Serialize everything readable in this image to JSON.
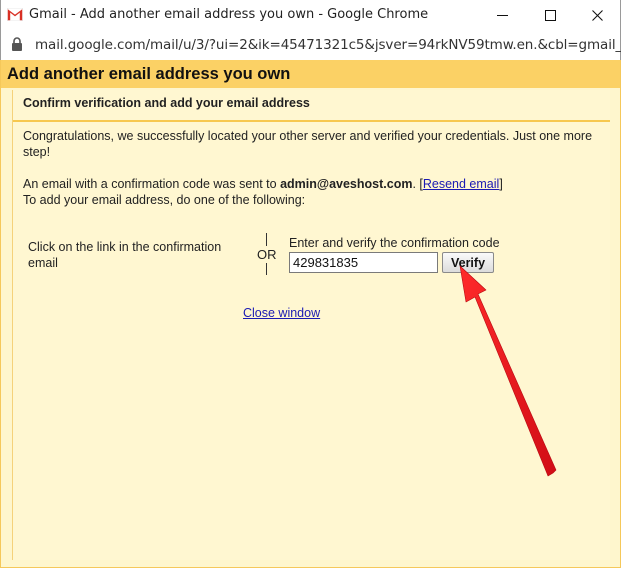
{
  "window": {
    "title": "Gmail - Add another email address you own - Google Chrome",
    "url": "mail.google.com/mail/u/3/?ui=2&ik=45471321c5&jsver=94rkNV59tmw.en.&cbl=gmail_fe...",
    "minimize_glyph": "—",
    "maximize_glyph": "☐",
    "close_glyph": "✕"
  },
  "page": {
    "title": "Add another email address you own",
    "section_title": "Confirm verification and add your email address",
    "congrats_text": "Congratulations, we successfully located your other server and verified your credentials. Just one more step!",
    "sent_prefix": "An email with a confirmation code was sent to ",
    "sent_email": "admin@aveshost.com",
    "sent_suffix": ". [",
    "resend_link": "Resend email",
    "resend_close": "]",
    "todo_text": "To add your email address, do one of the following:",
    "option_link_text": "Click on the link in the confirmation email",
    "or_text": "OR",
    "enter_code_label": "Enter and verify the confirmation code",
    "code_value": "429831835",
    "verify_button": "Verify",
    "close_window": "Close window"
  },
  "icons": {
    "app": "gmail-icon",
    "lock": "lock-icon",
    "annotation": "red-arrow-icon"
  },
  "colors": {
    "header_band": "#fbd165",
    "page_bg": "#fef6cd",
    "divider": "#f7c84f",
    "link": "#1a1ab3",
    "arrow": "#e8121e"
  }
}
